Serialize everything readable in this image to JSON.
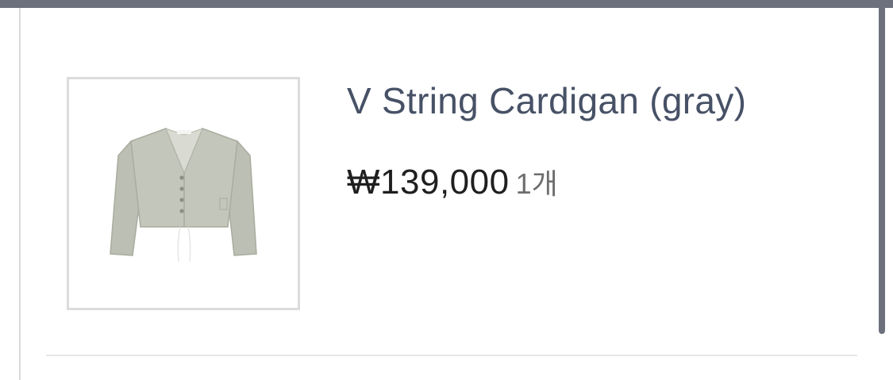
{
  "product": {
    "name": "V String Cardigan (gray)",
    "price": "₩139,000",
    "quantity": "1개",
    "image_alt": "gray v-neck cardigan"
  },
  "colors": {
    "top_bar": "#6d717d",
    "title": "#475166",
    "price": "#1f1f1f",
    "quantity": "#6e6e6e",
    "thumb_border": "#dcdcdc",
    "garment": "#bcbfb3"
  },
  "icons": {
    "product_image": "cardigan-icon"
  }
}
